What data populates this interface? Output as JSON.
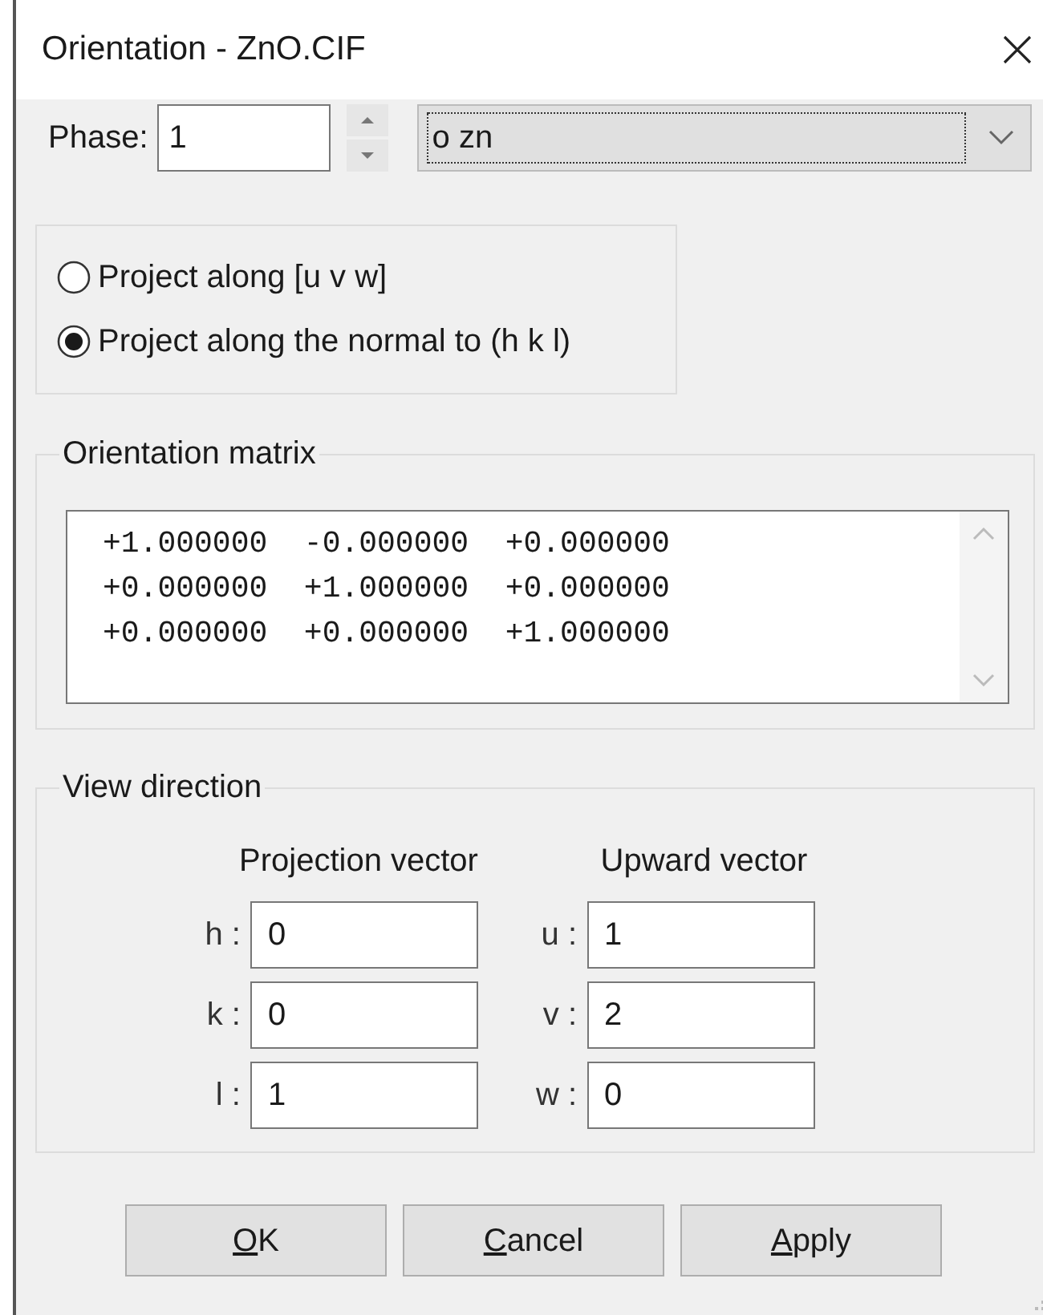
{
  "window": {
    "title": "Orientation - ZnO.CIF"
  },
  "phase": {
    "label": "Phase:",
    "value": "1",
    "combo_value": "o zn"
  },
  "projection_mode": [
    {
      "label": "Project along [u v w]",
      "selected": false
    },
    {
      "label": "Project along the normal to (h k l)",
      "selected": true
    }
  ],
  "orientation_matrix": {
    "title": "Orientation matrix",
    "rows": [
      "+1.000000  -0.000000  +0.000000",
      "+0.000000  +1.000000  +0.000000",
      "+0.000000  +0.000000  +1.000000"
    ]
  },
  "view_direction": {
    "title": "View direction",
    "columns": [
      {
        "heading": "Projection vector",
        "fields": [
          {
            "label": "h :",
            "value": "0"
          },
          {
            "label": "k :",
            "value": "0"
          },
          {
            "label": "l :",
            "value": "1"
          }
        ]
      },
      {
        "heading": "Upward vector",
        "fields": [
          {
            "label": "u :",
            "value": "1"
          },
          {
            "label": "v :",
            "value": "2"
          },
          {
            "label": "w :",
            "value": "0"
          }
        ]
      }
    ]
  },
  "buttons": [
    {
      "label": "OK"
    },
    {
      "label": "Cancel"
    },
    {
      "label": "Apply"
    }
  ]
}
